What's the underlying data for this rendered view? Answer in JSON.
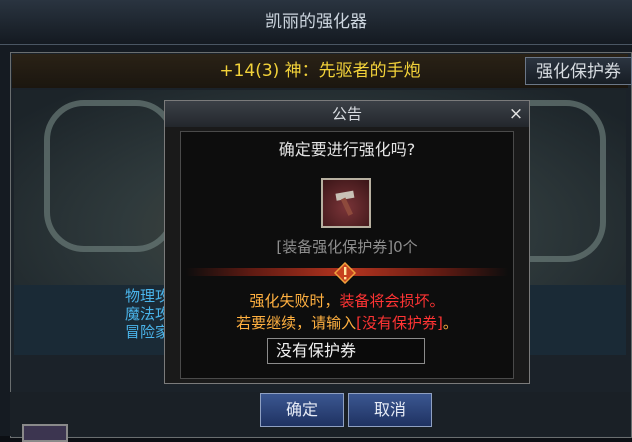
{
  "window": {
    "title": "凯丽的强化器"
  },
  "item": {
    "name": "+14(3) 神：先驱者的手炮"
  },
  "protect_button": {
    "label": "强化保护券"
  },
  "stats": [
    "物理攻",
    "魔法攻",
    "冒险家"
  ],
  "dialog": {
    "title": "公告",
    "close_symbol": "×",
    "question": "确定要进行强化吗?",
    "protect_count": "[装备强化保护券]0个",
    "warning_line1_a": "强化失败时，",
    "warning_line1_b": "装备将会损坏。",
    "warning_line2_a": "若要继续，请输入",
    "warning_line2_b": "[没有保护券]",
    "warning_line2_c": "。",
    "input_value": "没有保护券",
    "ok_label": "确定",
    "cancel_label": "取消"
  },
  "icons": {
    "item": "hand-cannon-icon",
    "warning": "warning-diamond-icon",
    "close": "close-icon"
  },
  "colors": {
    "gold": "#f2d23a",
    "warning": "#ffb040",
    "danger": "#ff3434",
    "stat": "#4ab4ea"
  }
}
